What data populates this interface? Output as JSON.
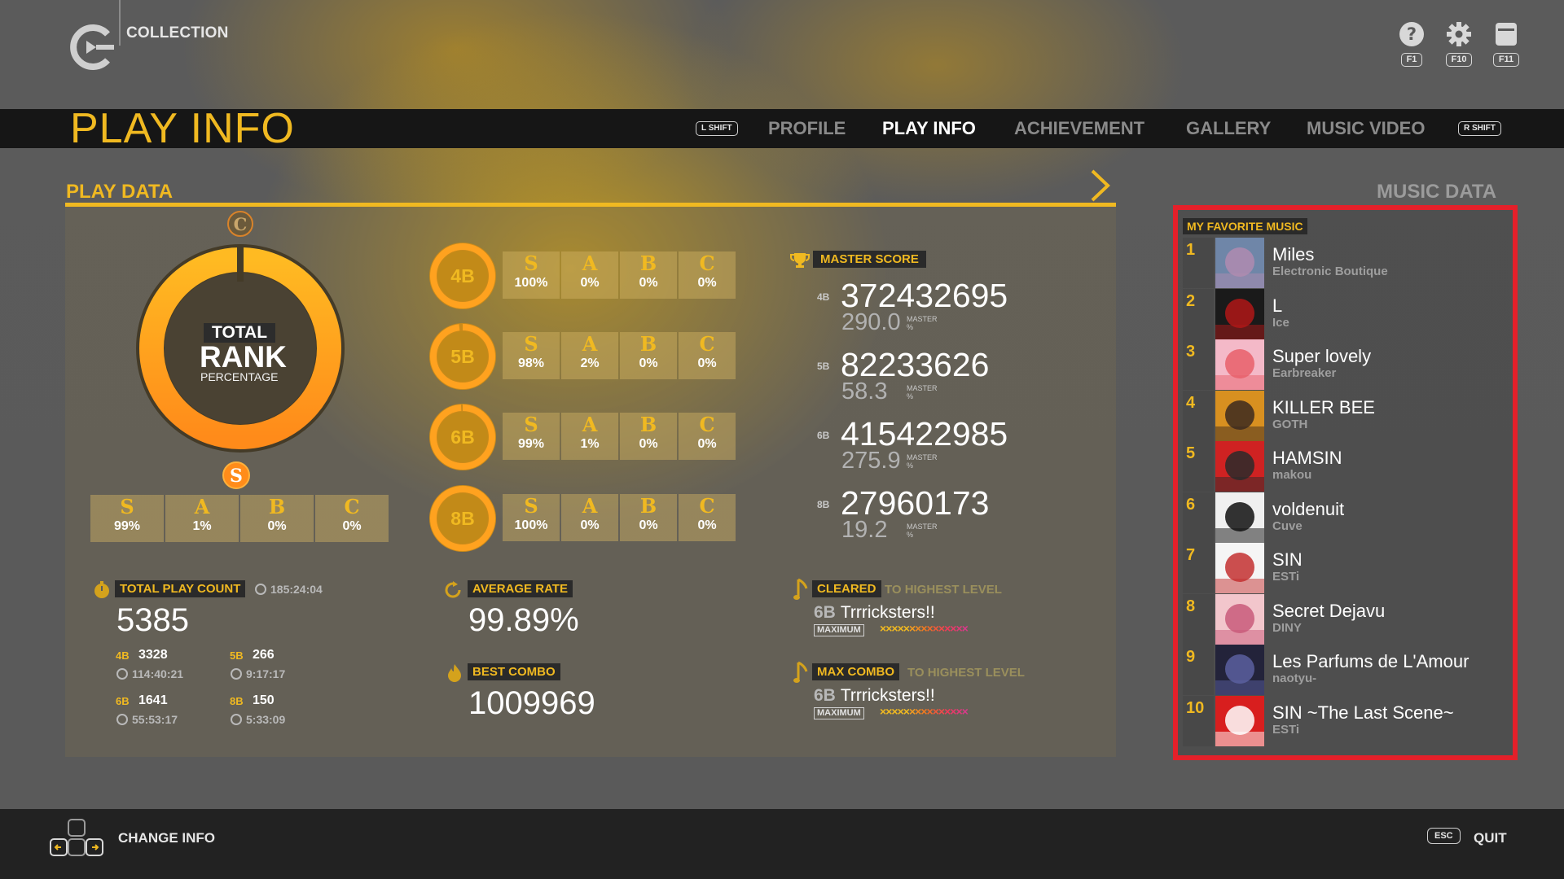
{
  "top": {
    "collection_label": "COLLECTION",
    "icons": [
      {
        "name": "help-icon",
        "key": "F1"
      },
      {
        "name": "gear-icon",
        "key": "F10"
      },
      {
        "name": "window-icon",
        "key": "F11"
      }
    ]
  },
  "header": {
    "title": "PLAY INFO",
    "left_shift": "L SHIFT",
    "right_shift": "R SHIFT",
    "tabs": [
      {
        "label": "PROFILE",
        "active": false
      },
      {
        "label": "PLAY INFO",
        "active": true
      },
      {
        "label": "ACHIEVEMENT",
        "active": false
      },
      {
        "label": "GALLERY",
        "active": false
      },
      {
        "label": "MUSIC VIDEO",
        "active": false
      }
    ]
  },
  "play_data": {
    "section_title": "PLAY DATA",
    "total": {
      "line1": "TOTAL",
      "line2": "RANK",
      "line3": "PERCENTAGE",
      "grades": [
        {
          "grade": "S",
          "value": "99%"
        },
        {
          "grade": "A",
          "value": "1%"
        },
        {
          "grade": "B",
          "value": "0%"
        },
        {
          "grade": "C",
          "value": "0%"
        }
      ]
    },
    "buttons": [
      {
        "label": "4B",
        "grades": [
          "100%",
          "0%",
          "0%",
          "0%"
        ]
      },
      {
        "label": "5B",
        "grades": [
          "98%",
          "2%",
          "0%",
          "0%"
        ]
      },
      {
        "label": "6B",
        "grades": [
          "99%",
          "1%",
          "0%",
          "0%"
        ]
      },
      {
        "label": "8B",
        "grades": [
          "100%",
          "0%",
          "0%",
          "0%"
        ]
      }
    ],
    "grade_letters": [
      "S",
      "A",
      "B",
      "C"
    ],
    "master_score": {
      "label": "MASTER SCORE",
      "rows": [
        {
          "btn": "4B",
          "score": "372432695",
          "rate": "290.0",
          "sub": "MASTER",
          "unit": "%"
        },
        {
          "btn": "5B",
          "score": "82233626",
          "rate": "58.3",
          "sub": "MASTER",
          "unit": "%"
        },
        {
          "btn": "6B",
          "score": "415422985",
          "rate": "275.9",
          "sub": "MASTER",
          "unit": "%"
        },
        {
          "btn": "8B",
          "score": "27960173",
          "rate": "19.2",
          "sub": "MASTER",
          "unit": "%"
        }
      ]
    },
    "total_play": {
      "label": "TOTAL PLAY COUNT",
      "time": "185:24:04",
      "count": "5385",
      "per_button": [
        {
          "btn": "4B",
          "count": "3328",
          "time": "114:40:21"
        },
        {
          "btn": "5B",
          "count": "266",
          "time": "9:17:17"
        },
        {
          "btn": "6B",
          "count": "1641",
          "time": "55:53:17"
        },
        {
          "btn": "8B",
          "count": "150",
          "time": "5:33:09"
        }
      ]
    },
    "average_rate": {
      "label": "AVERAGE RATE",
      "value": "99.89%"
    },
    "best_combo": {
      "label": "BEST COMBO",
      "value": "1009969"
    },
    "cleared": {
      "label": "CLEARED",
      "suffix": "TO HIGHEST LEVEL",
      "btn": "6B",
      "song": "Trrricksters!!",
      "tag": "MAXIMUM",
      "marks": "×××××××××××××××"
    },
    "max_combo": {
      "label": "MAX COMBO",
      "suffix": "TO HIGHEST LEVEL",
      "btn": "6B",
      "song": "Trrricksters!!",
      "tag": "MAXIMUM",
      "marks": "×××××××××××××××"
    }
  },
  "music_data": {
    "title": "MUSIC DATA",
    "favorites_label": "MY FAVORITE MUSIC",
    "items": [
      {
        "rank": "1",
        "title": "Miles",
        "artist": "Electronic Boutique",
        "c1": "#6f86a8",
        "c2": "#b08bb0"
      },
      {
        "rank": "2",
        "title": "L",
        "artist": "Ice",
        "c1": "#1a1a1a",
        "c2": "#b01818"
      },
      {
        "rank": "3",
        "title": "Super lovely",
        "artist": "Earbreaker",
        "c1": "#f4b9c8",
        "c2": "#e85f6a"
      },
      {
        "rank": "4",
        "title": "KILLER BEE",
        "artist": "GOTH",
        "c1": "#d89020",
        "c2": "#3c2a20"
      },
      {
        "rank": "5",
        "title": "HAMSIN",
        "artist": "makou",
        "c1": "#cf2222",
        "c2": "#2a2a2a"
      },
      {
        "rank": "6",
        "title": "voldenuit",
        "artist": "Cuve",
        "c1": "#f0f0f0",
        "c2": "#111111"
      },
      {
        "rank": "7",
        "title": "SIN",
        "artist": "ESTi",
        "c1": "#f5f5f5",
        "c2": "#c33030"
      },
      {
        "rank": "8",
        "title": "Secret Dejavu",
        "artist": "DINY",
        "c1": "#f2c6cc",
        "c2": "#c95a7a"
      },
      {
        "rank": "9",
        "title": "Les Parfums de L'Amour",
        "artist": "naotyu-",
        "c1": "#23233a",
        "c2": "#5a5fa0"
      },
      {
        "rank": "10",
        "title": "SIN ~The Last Scene~",
        "artist": "ESTi",
        "c1": "#d81e1e",
        "c2": "#ffffff"
      }
    ]
  },
  "footer": {
    "change_info": "CHANGE INFO",
    "esc": "ESC",
    "quit": "QUIT"
  },
  "colors": {
    "accent": "#f0b921",
    "ring_orange": "#ff9a1f",
    "highlight_box": "#e4202a"
  }
}
